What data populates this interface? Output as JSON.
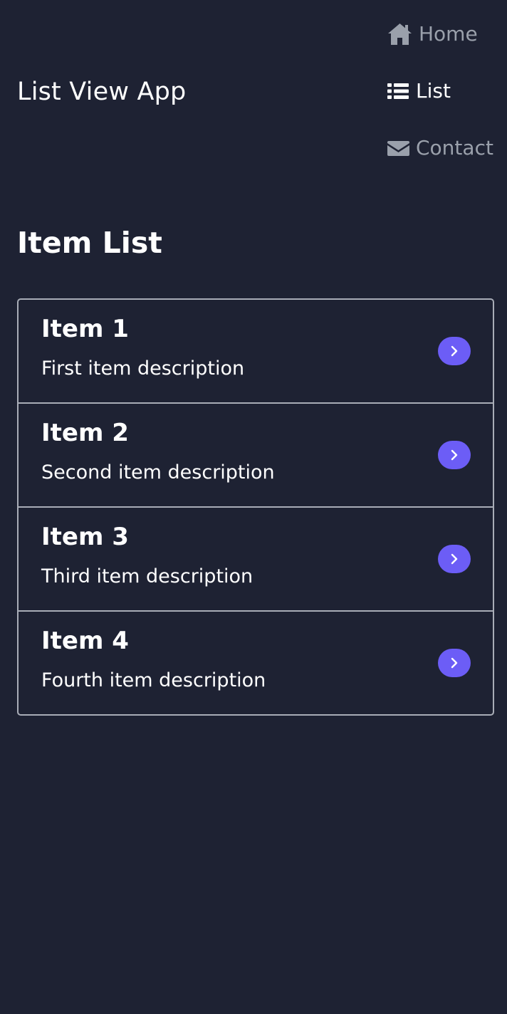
{
  "app": {
    "title": "List View App"
  },
  "nav": {
    "items": [
      {
        "label": "Home",
        "icon": "home-icon",
        "active": false
      },
      {
        "label": "List",
        "icon": "list-icon",
        "active": true
      },
      {
        "label": "Contact",
        "icon": "envelope-icon",
        "active": false
      }
    ]
  },
  "main": {
    "heading": "Item List",
    "items": [
      {
        "title": "Item 1",
        "description": "First item description",
        "action_icon": "chevron-right-icon"
      },
      {
        "title": "Item 2",
        "description": "Second item description",
        "action_icon": "chevron-right-icon"
      },
      {
        "title": "Item 3",
        "description": "Third item description",
        "action_icon": "chevron-right-icon"
      },
      {
        "title": "Item 4",
        "description": "Fourth item description",
        "action_icon": "chevron-right-icon"
      }
    ]
  },
  "colors": {
    "background": "#1e2233",
    "text_primary": "#ffffff",
    "nav_inactive": "#9aa0ab",
    "list_border": "#a9adb7",
    "accent": "#6c5df6"
  }
}
